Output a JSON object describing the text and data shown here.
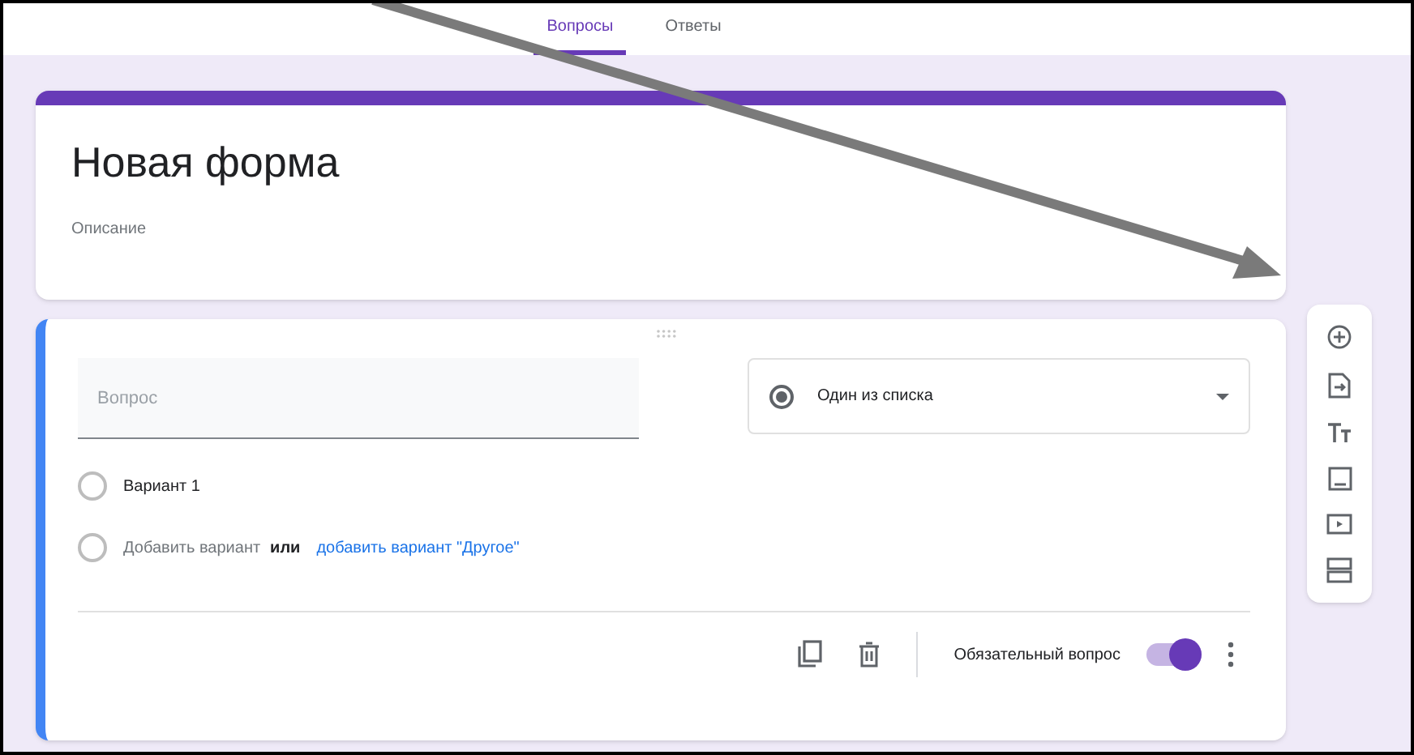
{
  "tabs": [
    {
      "label": "Вопросы",
      "selected": true
    },
    {
      "label": "Ответы",
      "selected": false
    }
  ],
  "form": {
    "title": "Новая форма",
    "description": "Описание"
  },
  "question": {
    "placeholder": "Вопрос",
    "type": "Один из списка",
    "options": [
      {
        "label": "Вариант 1",
        "selected": false
      }
    ],
    "add_option": "Добавить вариант",
    "add_option_selected": false,
    "or": "или",
    "add_other": "добавить вариант \"Другое\"",
    "required": {
      "label": "Обязательный вопрос",
      "on": true
    }
  }
}
